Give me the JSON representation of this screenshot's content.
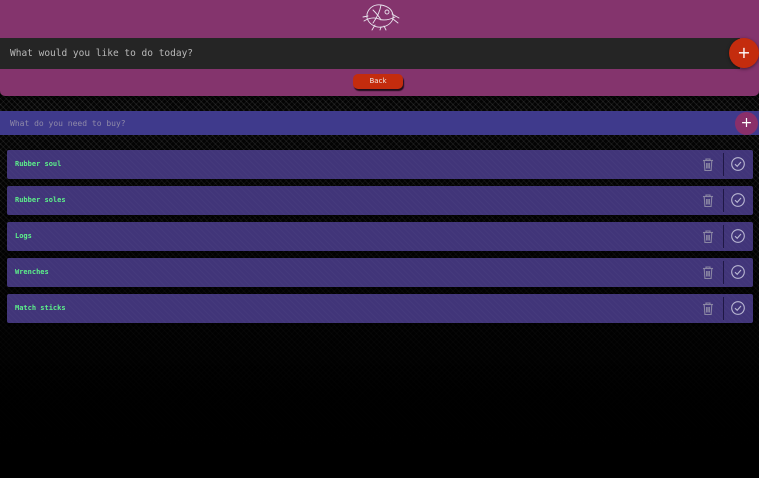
{
  "header": {
    "logo_icon": "drawn-logo-icon",
    "todo_input": {
      "placeholder": "What would you like to do today?",
      "value": ""
    },
    "add_button_label": "+",
    "back_label": "Back"
  },
  "shopping": {
    "input": {
      "placeholder": "What do you need to buy?",
      "value": ""
    },
    "add_button_label": "+",
    "items": [
      {
        "label": "Rubber soul"
      },
      {
        "label": "Rubber soles"
      },
      {
        "label": "Logs"
      },
      {
        "label": "Wrenches"
      },
      {
        "label": "Match sticks"
      }
    ],
    "item_icons": {
      "delete": "trash-icon",
      "complete": "check-circle-icon"
    }
  },
  "colors": {
    "header_bg": "#84346d",
    "input_bg": "#252525",
    "accent_red": "#c42c0e",
    "shop_bar": "#3f3a8c",
    "item_bg": "#413579",
    "item_text": "#5cf08a",
    "add_item_btn": "#8a2f6a"
  }
}
